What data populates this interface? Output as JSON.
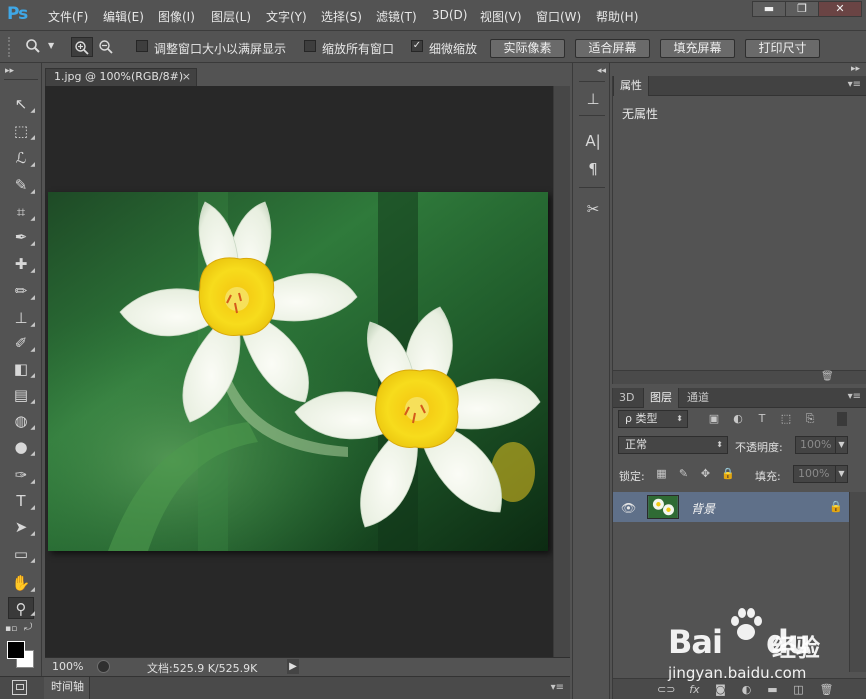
{
  "app": {
    "logo": "Ps",
    "menu": [
      "文件(F)",
      "编辑(E)",
      "图像(I)",
      "图层(L)",
      "文字(Y)",
      "选择(S)",
      "滤镜(T)",
      "3D(D)",
      "视图(V)",
      "窗口(W)",
      "帮助(H)"
    ],
    "window_controls": {
      "minimize": "▬",
      "maximize": "❐",
      "close": "✕"
    }
  },
  "options_bar": {
    "checkbox_1": {
      "label": "调整窗口大小以满屏显示",
      "checked": false
    },
    "checkbox_2": {
      "label": "缩放所有窗口",
      "checked": false
    },
    "checkbox_3": {
      "label": "细微缩放",
      "checked": true,
      "mark": "✓"
    },
    "buttons": [
      "实际像素",
      "适合屏幕",
      "填充屏幕",
      "打印尺寸"
    ]
  },
  "tools": [
    {
      "name": "move-tool",
      "glyph": "↖"
    },
    {
      "name": "marquee-tool",
      "glyph": "⬚"
    },
    {
      "name": "lasso-tool",
      "glyph": "ℒ"
    },
    {
      "name": "quick-select-tool",
      "glyph": "✎"
    },
    {
      "name": "crop-tool",
      "glyph": "⌗"
    },
    {
      "name": "eyedropper-tool",
      "glyph": "✒"
    },
    {
      "name": "healing-brush-tool",
      "glyph": "✚"
    },
    {
      "name": "brush-tool",
      "glyph": "✏"
    },
    {
      "name": "clone-stamp-tool",
      "glyph": "⊥"
    },
    {
      "name": "history-brush-tool",
      "glyph": "✐"
    },
    {
      "name": "eraser-tool",
      "glyph": "◧"
    },
    {
      "name": "gradient-tool",
      "glyph": "▤"
    },
    {
      "name": "blur-tool",
      "glyph": "◍"
    },
    {
      "name": "dodge-tool",
      "glyph": "●"
    },
    {
      "name": "pen-tool",
      "glyph": "✑"
    },
    {
      "name": "type-tool",
      "glyph": "T"
    },
    {
      "name": "path-select-tool",
      "glyph": "➤"
    },
    {
      "name": "shape-tool",
      "glyph": "▭"
    },
    {
      "name": "hand-tool",
      "glyph": "✋"
    },
    {
      "name": "zoom-tool",
      "glyph": "⚲"
    }
  ],
  "document": {
    "tab_title": "1.jpg @ 100%(RGB/8#)",
    "tab_close": "×",
    "zoom": "100%",
    "doc_size": "文档:525.9 K/525.9K",
    "arrow": "▶"
  },
  "timeline": {
    "label": "时间轴"
  },
  "properties_panel": {
    "tab": "属性",
    "content": "无属性"
  },
  "layers_panel": {
    "tabs": [
      "3D",
      "图层",
      "通道"
    ],
    "filter": "ρ 类型",
    "blend_mode": "正常",
    "opacity_label": "不透明度:",
    "opacity_value": "100%",
    "lock_label": "锁定:",
    "fill_label": "填充:",
    "fill_value": "100%",
    "layer": {
      "name": "背景",
      "visible": true,
      "locked": true
    }
  },
  "watermark": {
    "brand_bai": "Bai",
    "brand_du": "du",
    "jingyan": "经验",
    "url": "jingyan.baidu.com"
  }
}
